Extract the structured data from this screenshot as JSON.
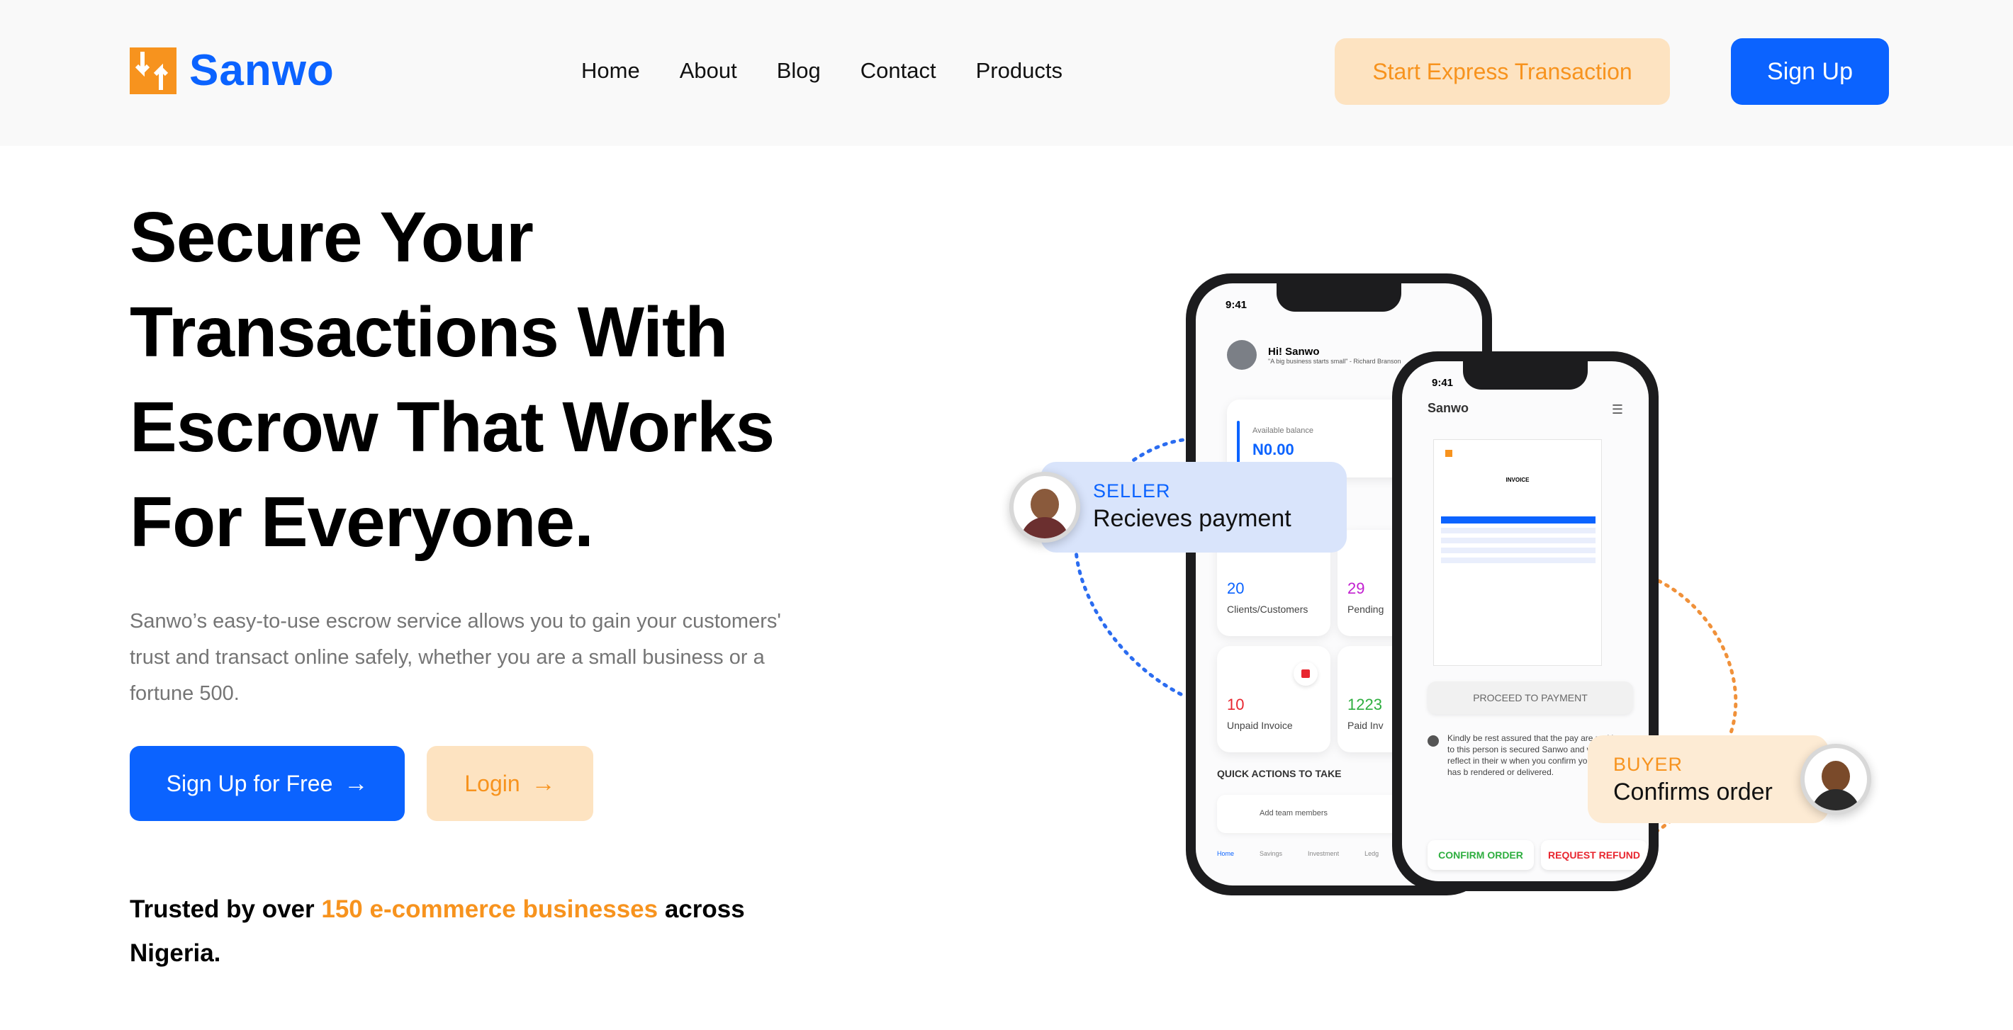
{
  "header": {
    "brand": "Sanwo",
    "nav": [
      "Home",
      "About",
      "Blog",
      "Contact",
      "Products"
    ],
    "express_button": "Start Express Transaction",
    "signup_button": "Sign Up"
  },
  "hero": {
    "title": "Secure Your Transactions With Escrow That Works For Everyone.",
    "description": "Sanwo’s easy-to-use escrow service allows you to gain your customers' trust and transact online safely, whether you are a small business or a fortune 500.",
    "primary_button": "Sign Up for Free",
    "secondary_button": "Login",
    "trust_prefix": "Trusted by over",
    "trust_highlight": "150 e-commerce businesses",
    "trust_suffix": "across Nigeria."
  },
  "illustration": {
    "seller_tag": "SELLER",
    "seller_msg": "Recieves payment",
    "buyer_tag": "BUYER",
    "buyer_msg": "Confirms order",
    "phone1": {
      "time": "9:41",
      "greeting": "Hi! Sanwo",
      "quote": "\"A big business starts small\" - Richard Branson",
      "balance_label": "Available balance",
      "balance_value": "N0.00",
      "stats": [
        {
          "num": "20",
          "label": "Clients/Customers"
        },
        {
          "num": "29",
          "label": "Pending"
        },
        {
          "num": "10",
          "label": "Unpaid Invoice"
        },
        {
          "num": "1223",
          "label": "Paid Inv"
        }
      ],
      "quick_actions": "QUICK ACTIONS TO TAKE",
      "add_team": "Add team members",
      "tabs": [
        "Home",
        "Savings",
        "Investment",
        "Ledg"
      ]
    },
    "phone2": {
      "time": "9:41",
      "title": "Sanwo",
      "invoice_title": "INVOICE",
      "proceed": "PROCEED TO PAYMENT",
      "note": "Kindly be rest assured that the pay are making to this person is secured Sanwo and will only reflect in their w when you confirm your service has b rendered or delivered.",
      "confirm": "CONFIRM ORDER",
      "refund": "REQUEST REFUND"
    }
  },
  "colors": {
    "brand_blue": "#0b63ff",
    "brand_orange": "#f7931e",
    "orange_tint": "#fde3c1"
  }
}
